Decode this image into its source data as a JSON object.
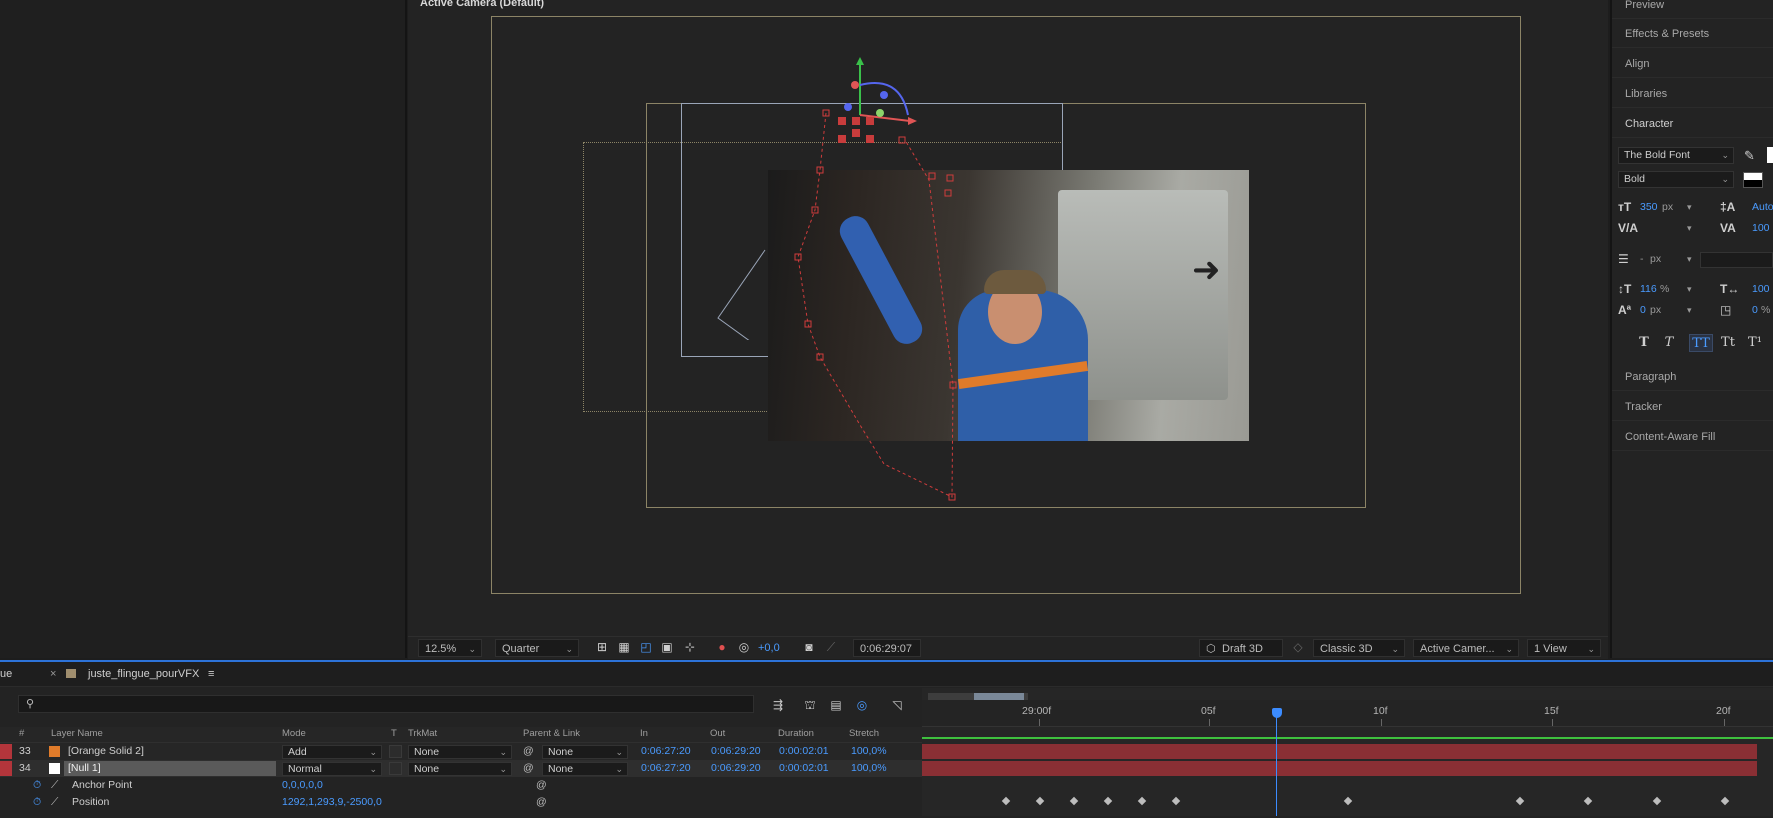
{
  "viewer": {
    "title": "Active Camera (Default)",
    "toolbar": {
      "zoom": "12.5%",
      "resolution": "Quarter",
      "exposure": "+0,0",
      "timecode": "0:06:29:07",
      "renderer_draft": "Draft 3D",
      "renderer": "Classic 3D",
      "camera": "Active Camer...",
      "views": "1 View"
    }
  },
  "right_panel": {
    "sections": [
      "Preview",
      "Effects & Presets",
      "Align",
      "Libraries",
      "Character",
      "Paragraph",
      "Tracker",
      "Content-Aware Fill"
    ],
    "character": {
      "font": "The Bold Font",
      "style": "Bold",
      "size_value": "350",
      "size_unit": "px",
      "leading_value": "Auto",
      "tracking_value": "100",
      "stroke_value": "-",
      "stroke_unit": "px",
      "vscale_value": "116",
      "vscale_unit": "%",
      "hscale_value": "100",
      "baseline_value": "0",
      "baseline_unit": "px",
      "tsume_value": "0",
      "tsume_unit": "%",
      "format_buttons": [
        "T",
        "T",
        "TT",
        "Tt",
        "T¹"
      ]
    }
  },
  "timeline": {
    "tab_prev": "ue",
    "tab_active": "juste_flingue_pourVFX",
    "columns": {
      "num": "#",
      "layer_name": "Layer Name",
      "mode": "Mode",
      "t": "T",
      "trkmat": "TrkMat",
      "parent": "Parent & Link",
      "in": "In",
      "out": "Out",
      "duration": "Duration",
      "stretch": "Stretch"
    },
    "layers": [
      {
        "num": "33",
        "name": "[Orange Solid 2]",
        "color": "#e07b2a",
        "mode": "Add",
        "trkmat": "None",
        "parent": "None",
        "in": "0:06:27:20",
        "out": "0:06:29:20",
        "duration": "0:00:02:01",
        "stretch": "100,0%"
      },
      {
        "num": "34",
        "name": "[Null 1]",
        "color": "#ffffff",
        "mode": "Normal",
        "trkmat": "None",
        "parent": "None",
        "in": "0:06:27:20",
        "out": "0:06:29:20",
        "duration": "0:00:02:01",
        "stretch": "100,0%"
      }
    ],
    "properties": [
      {
        "name": "Anchor Point",
        "value": "0,0,0,0,0"
      },
      {
        "name": "Position",
        "value": "1292,1,293,9,-2500,0"
      }
    ],
    "ruler": [
      "29:00f",
      "05f",
      "10f",
      "15f",
      "20f"
    ]
  },
  "colors": {
    "accent": "#2d73d9",
    "value_blue": "#4a9bff",
    "track_red": "#8a2f34",
    "layer_label_red": "#b3353b"
  }
}
